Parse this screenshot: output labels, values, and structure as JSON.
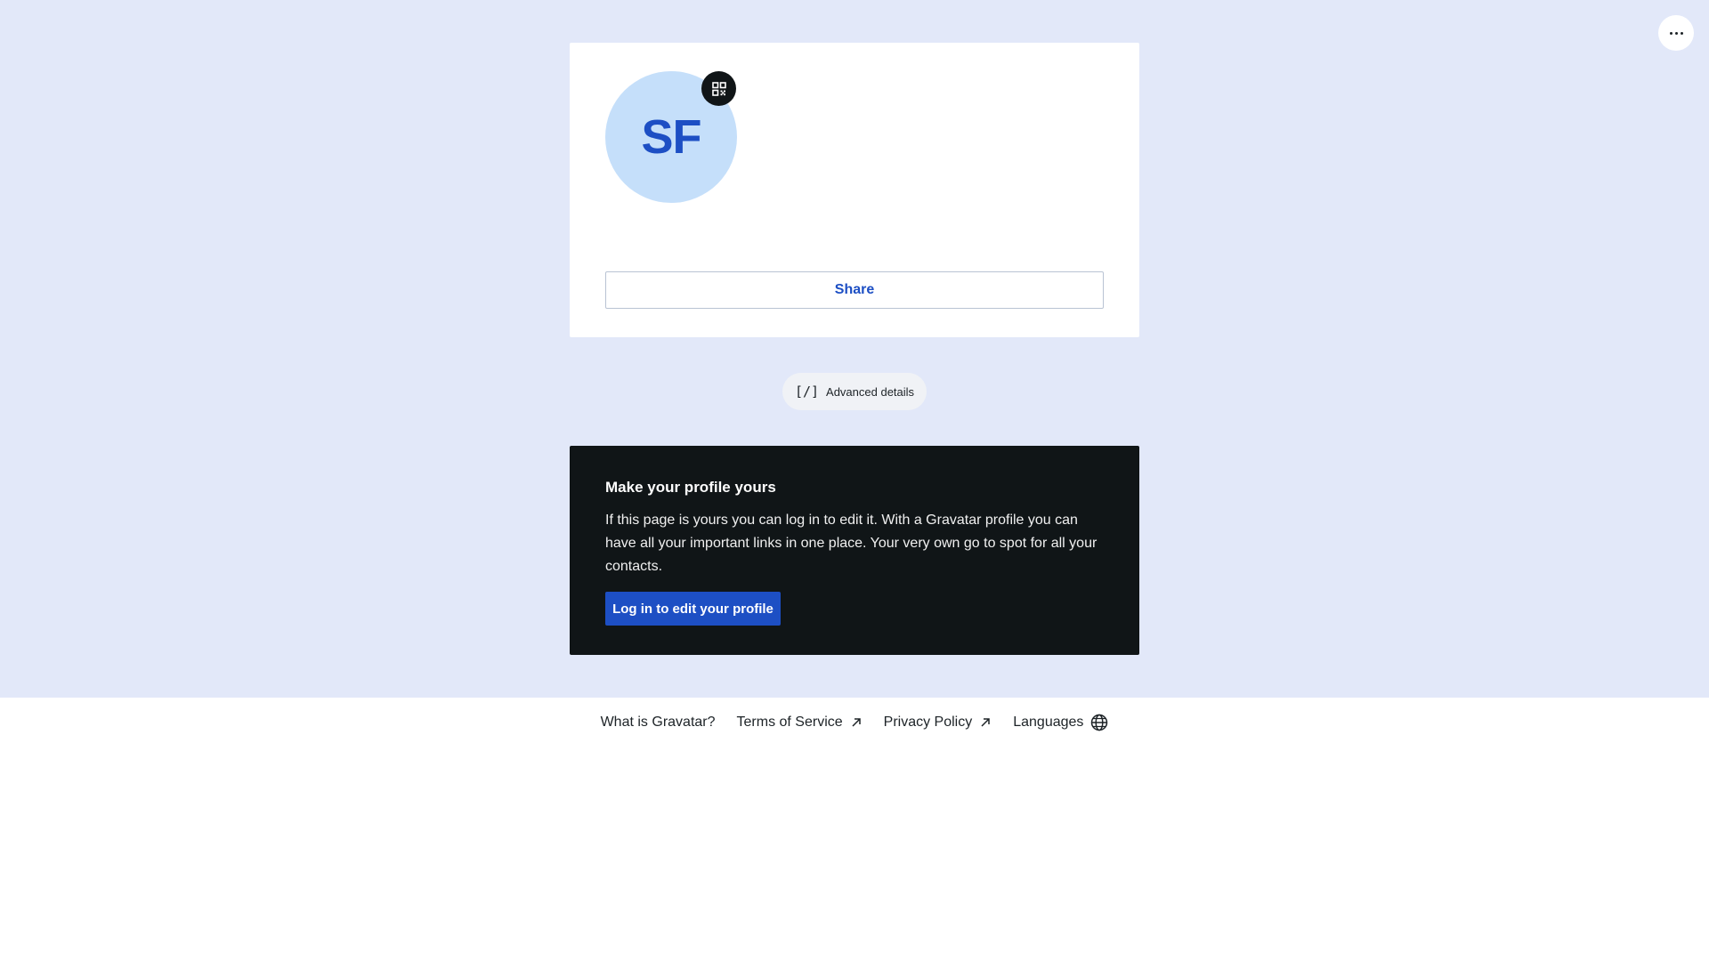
{
  "header": {
    "more_icon": "ellipsis-icon"
  },
  "profile": {
    "initials": "SF",
    "qr_icon": "qr-code-icon",
    "share_label": "Share"
  },
  "advanced": {
    "icon": "code-brackets-icon",
    "icon_glyph": "[/]",
    "label": "Advanced details"
  },
  "cta": {
    "title": "Make your profile yours",
    "text": "If this page is yours you can log in to edit it. With a Gravatar profile you can have all your important links in one place. Your very own go to spot for all your contacts.",
    "button_label": "Log in to edit your profile"
  },
  "footer": {
    "links": [
      {
        "label": "What is Gravatar?"
      },
      {
        "label": "Terms of Service",
        "icon": "external-arrow-icon"
      },
      {
        "label": "Privacy Policy",
        "icon": "external-arrow-icon"
      },
      {
        "label": "Languages",
        "icon": "globe-icon"
      }
    ]
  },
  "colors": {
    "background": "#e2e8f9",
    "accent": "#1d4fc4",
    "avatar_bg": "#c5dffa",
    "dark_card": "#101517"
  }
}
